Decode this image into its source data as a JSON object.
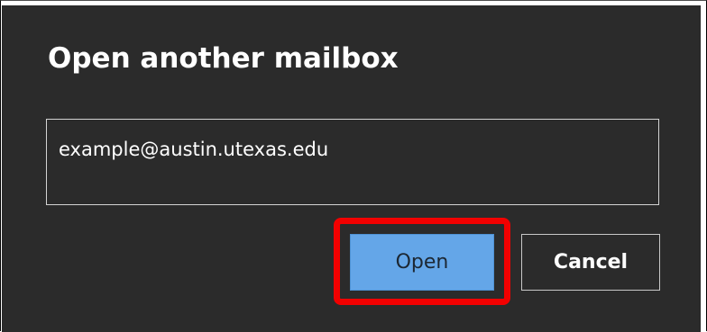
{
  "dialog": {
    "title": "Open another mailbox",
    "mailbox_input": {
      "value": "example@austin.utexas.edu",
      "placeholder": ""
    },
    "buttons": {
      "open_label": "Open",
      "cancel_label": "Cancel"
    },
    "highlight_target": "open-button"
  },
  "colors": {
    "dialog_background": "#2b2b2b",
    "primary_button": "#64a6e8",
    "highlight_outline": "#f20000",
    "text": "#ffffff"
  }
}
